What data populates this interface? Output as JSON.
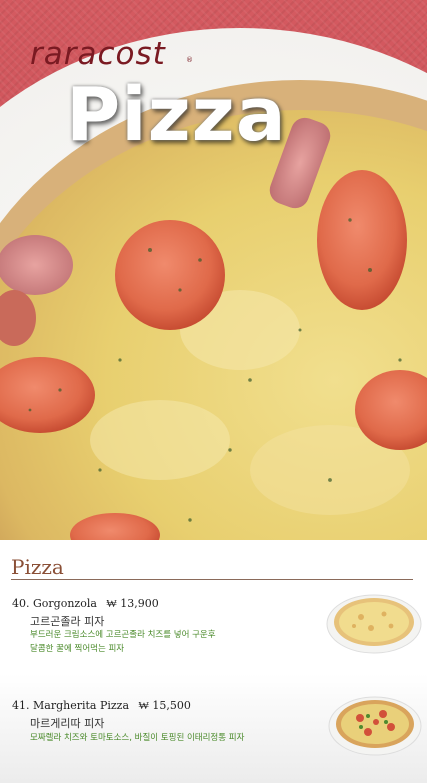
{
  "brand": {
    "name": "raracost",
    "registered": "®"
  },
  "hero": {
    "title": "Pizza"
  },
  "section": {
    "title": "Pizza"
  },
  "items": [
    {
      "number": "40.",
      "name": "Gorgonzola",
      "price": "₩ 13,900",
      "name_ko": "고르곤졸라 피자",
      "desc_line1": "부드러운 크림소스에 고르곤졸라 치즈를 넣어 구운후",
      "desc_line2": "달콤한 꿀에 찍어먹는 피자"
    },
    {
      "number": "41.",
      "name": "Margherita Pizza",
      "price": "₩ 15,500",
      "name_ko": "마르게리따 피자",
      "desc_line1": "모짜렐라 치즈와 토마토소스, 바질이 토핑된 이태리정통 피자"
    }
  ],
  "colors": {
    "accent": "#8a4f36",
    "brand": "#7a1a22",
    "desc": "#4a8a2a",
    "background_red": "#c94a52"
  }
}
